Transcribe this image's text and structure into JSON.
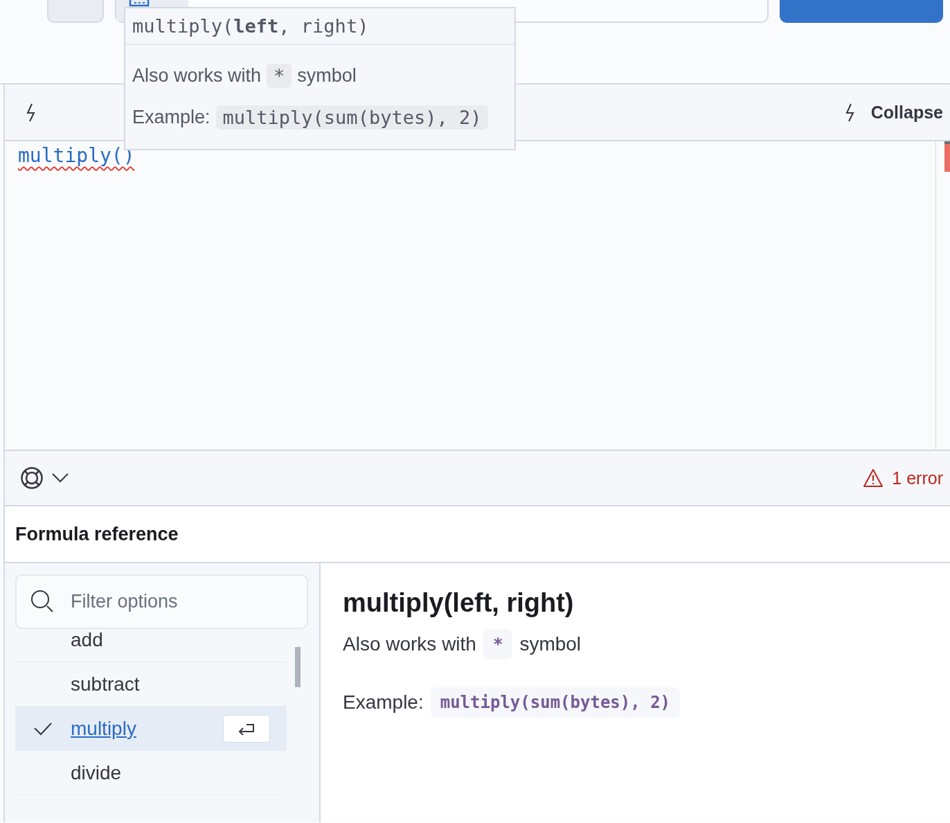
{
  "tooltip": {
    "signature": "multiply(**left**, right)",
    "symbol_before": "Also works with",
    "symbol": "*",
    "symbol_after": "symbol",
    "example_label": "Example:",
    "example": "multiply(sum(bytes), 2)"
  },
  "editor": {
    "collapse_label": "Collapse",
    "code": "multiply()",
    "has_error": true
  },
  "footer": {
    "error_count": "1 error"
  },
  "reference": {
    "title": "Formula reference",
    "search": {
      "placeholder": "Filter options"
    },
    "functions": [
      {
        "name": "add",
        "selected": false
      },
      {
        "name": "subtract",
        "selected": false
      },
      {
        "name": "multiply",
        "selected": true
      },
      {
        "name": "divide",
        "selected": false
      }
    ],
    "detail": {
      "heading": "multiply(left, right)",
      "symbol_before": "Also works with",
      "symbol": "*",
      "symbol_after": "symbol",
      "example_label": "Example:",
      "example": "multiply(sum(bytes), 2)"
    }
  }
}
